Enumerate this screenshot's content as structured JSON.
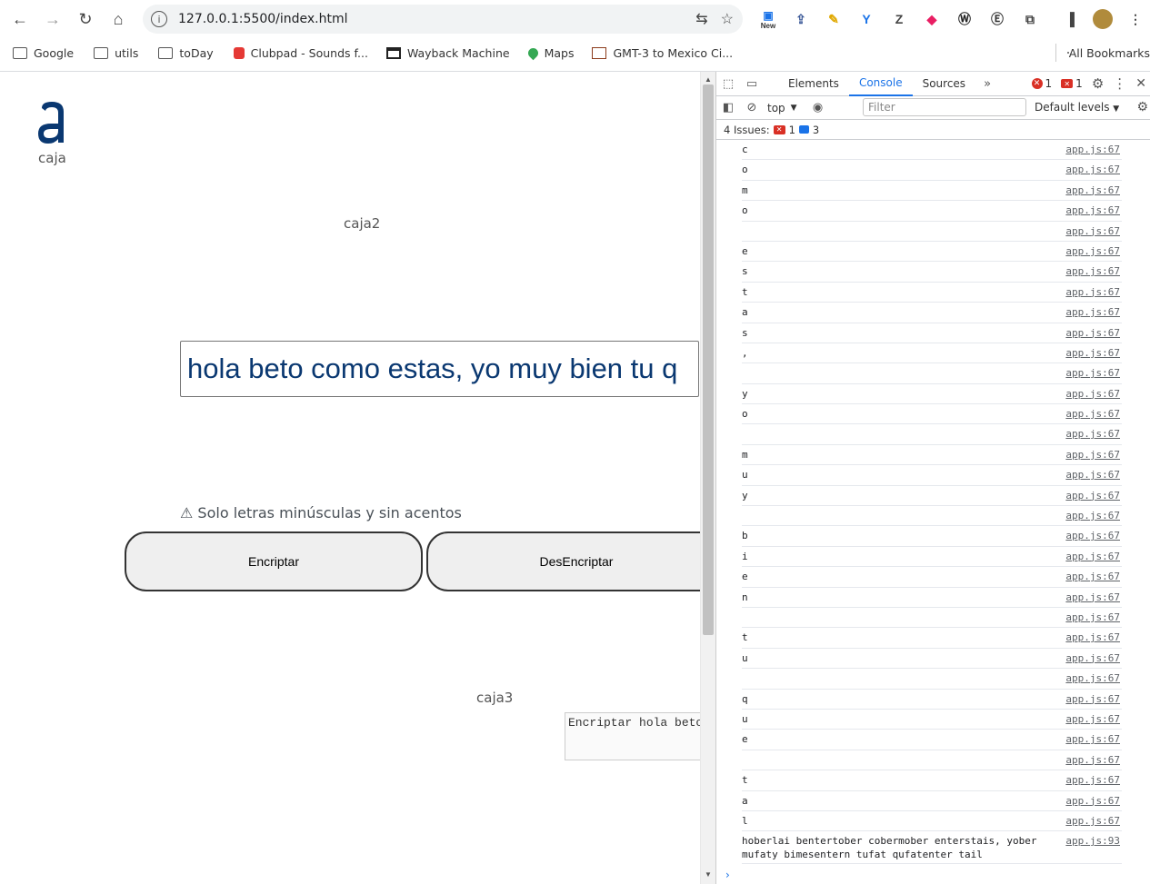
{
  "browser": {
    "url": "127.0.0.1:5500/index.html",
    "new_badge": "New",
    "bookmarks": [
      {
        "label": "Google",
        "icon": "folder-icon"
      },
      {
        "label": "utils",
        "icon": "folder-icon"
      },
      {
        "label": "toDay",
        "icon": "folder-icon"
      },
      {
        "label": "Clubpad - Sounds f...",
        "icon": "clubpad-icon"
      },
      {
        "label": "Wayback Machine",
        "icon": "wayback-icon"
      },
      {
        "label": "Maps",
        "icon": "maps-icon"
      },
      {
        "label": "GMT-3 to Mexico Ci...",
        "icon": "timezone-icon"
      }
    ],
    "all_bookmarks": "All Bookmarks"
  },
  "page": {
    "logo_letter": "a",
    "logo_label": "caja",
    "caja2_label": "caja2",
    "input_value": "hola beto como estas, yo muy bien tu q",
    "warning": "⚠ Solo letras minúsculas y sin acentos",
    "encrypt_button": "Encriptar",
    "decrypt_button": "DesEncriptar",
    "caja3_label": "caja3",
    "output_value": "Encriptar hola beto"
  },
  "devtools": {
    "tabs": [
      "Elements",
      "Console",
      "Sources"
    ],
    "active_tab": "Console",
    "more_tabs": "»",
    "error_count": "1",
    "issue_count_badge": "1",
    "context": "top",
    "filter_placeholder": "Filter",
    "levels": "Default levels",
    "issues_text": "4 Issues:",
    "issues_error": "1",
    "issues_info": "3",
    "logs": [
      {
        "msg": "c",
        "src": "app.js:67"
      },
      {
        "msg": "o",
        "src": "app.js:67"
      },
      {
        "msg": "m",
        "src": "app.js:67"
      },
      {
        "msg": "o",
        "src": "app.js:67"
      },
      {
        "msg": "",
        "src": "app.js:67"
      },
      {
        "msg": "e",
        "src": "app.js:67"
      },
      {
        "msg": "s",
        "src": "app.js:67"
      },
      {
        "msg": "t",
        "src": "app.js:67"
      },
      {
        "msg": "a",
        "src": "app.js:67"
      },
      {
        "msg": "s",
        "src": "app.js:67"
      },
      {
        "msg": ",",
        "src": "app.js:67"
      },
      {
        "msg": "",
        "src": "app.js:67"
      },
      {
        "msg": "y",
        "src": "app.js:67"
      },
      {
        "msg": "o",
        "src": "app.js:67"
      },
      {
        "msg": "",
        "src": "app.js:67"
      },
      {
        "msg": "m",
        "src": "app.js:67"
      },
      {
        "msg": "u",
        "src": "app.js:67"
      },
      {
        "msg": "y",
        "src": "app.js:67"
      },
      {
        "msg": "",
        "src": "app.js:67"
      },
      {
        "msg": "b",
        "src": "app.js:67"
      },
      {
        "msg": "i",
        "src": "app.js:67"
      },
      {
        "msg": "e",
        "src": "app.js:67"
      },
      {
        "msg": "n",
        "src": "app.js:67"
      },
      {
        "msg": "",
        "src": "app.js:67"
      },
      {
        "msg": "t",
        "src": "app.js:67"
      },
      {
        "msg": "u",
        "src": "app.js:67"
      },
      {
        "msg": "",
        "src": "app.js:67"
      },
      {
        "msg": "q",
        "src": "app.js:67"
      },
      {
        "msg": "u",
        "src": "app.js:67"
      },
      {
        "msg": "e",
        "src": "app.js:67"
      },
      {
        "msg": "",
        "src": "app.js:67"
      },
      {
        "msg": "t",
        "src": "app.js:67"
      },
      {
        "msg": "a",
        "src": "app.js:67"
      },
      {
        "msg": "l",
        "src": "app.js:67"
      }
    ],
    "final_log": {
      "msg": "hoberlai bentertober cobermober enterstais, yober mufaty bimesentern tufat qufatenter tail",
      "src": "app.js:93"
    }
  },
  "colors": {
    "brand": "#0a3871",
    "accent": "#1a73e8",
    "error": "#d93025"
  }
}
